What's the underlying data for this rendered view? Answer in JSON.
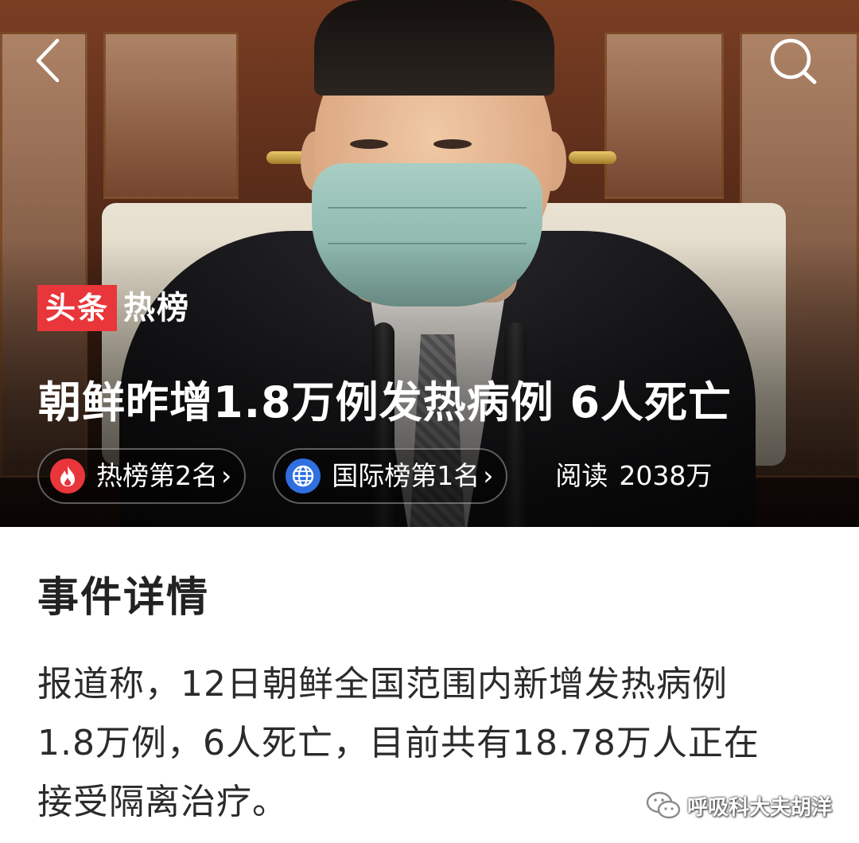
{
  "nav": {
    "back_icon": "chevron-left-icon",
    "search_icon": "search-icon"
  },
  "brand": {
    "tag": "头条",
    "rest": "热榜",
    "accent_color": "#e8363a"
  },
  "headline": "朝鲜昨增1.8万例发热病例 6人死亡",
  "pills": [
    {
      "icon": "flame-icon",
      "icon_color": "#e8363a",
      "label": "热榜第2名",
      "arrow": "›"
    },
    {
      "icon": "globe-icon",
      "icon_color": "#2f6fe0",
      "label": "国际榜第1名",
      "arrow": "›"
    }
  ],
  "reads": {
    "label": "阅读",
    "value": "2038万"
  },
  "section": {
    "title": "事件详情",
    "lines": [
      "报道称，12日朝鲜全国范围内新增发热病例",
      "1.8万例，6人死亡，目前共有18.78万人正在",
      "接受隔离治疗。"
    ]
  },
  "watermark": {
    "icon": "wechat-icon",
    "text": "呼吸科大夫胡洋"
  }
}
